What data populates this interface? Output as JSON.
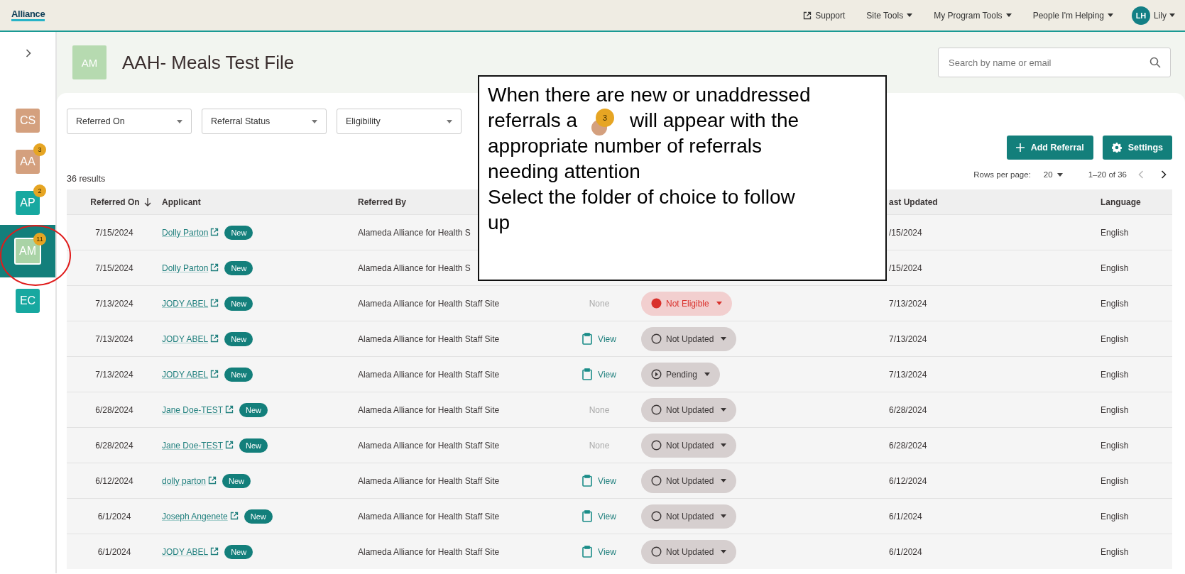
{
  "top_bar": {
    "logo": "Alliance",
    "nav": [
      {
        "label": "Support",
        "kind": "external"
      },
      {
        "label": "Site Tools",
        "kind": "menu"
      },
      {
        "label": "My Program Tools",
        "kind": "menu"
      },
      {
        "label": "People I'm Helping",
        "kind": "menu"
      }
    ],
    "user": {
      "initials": "LH",
      "name": "Lily"
    }
  },
  "sidebar": {
    "items": [
      {
        "initials": "CS",
        "color": "#d4a07e",
        "selected": false
      },
      {
        "initials": "AA",
        "color": "#d4a07e",
        "badge": "3",
        "selected": false
      },
      {
        "initials": "AP",
        "color": "#17a8a0",
        "badge": "2",
        "selected": false
      },
      {
        "initials": "AM",
        "color": "#a9d3a6",
        "badge": "11",
        "selected": true
      },
      {
        "initials": "EC",
        "color": "#17a8a0",
        "selected": false
      }
    ]
  },
  "header": {
    "initials": "AM",
    "title": "AAH- Meals Test File",
    "search": {
      "placeholder": "Search by name or email"
    }
  },
  "filters": [
    "Referred On",
    "Referral Status",
    "Eligibility"
  ],
  "buttons": [
    {
      "label": "Add Referral",
      "kind": "add"
    },
    {
      "label": "Settings",
      "kind": "settings"
    }
  ],
  "results": "36 results",
  "pagination": {
    "rows_label": "Rows per page:",
    "rows_value": "20",
    "range": "1–20 of 36",
    "prev_disabled": true
  },
  "table": {
    "columns": [
      {
        "label": "Referred On",
        "sorted": true
      },
      {
        "label": "Applicant",
        "sorted": false
      },
      {
        "label": "Referred By",
        "sorted": false
      },
      {
        "label": "ast Updated",
        "sorted": false
      },
      {
        "label": "Language",
        "sorted": false
      }
    ],
    "rows": [
      {
        "referred_on": "7/15/2024",
        "applicant": "Dolly Parton",
        "badge": "New",
        "referred_by": "Alameda Alliance for Health S",
        "last_updated": "/15/2024",
        "language": "English"
      },
      {
        "referred_on": "7/15/2024",
        "applicant": "Dolly Parton",
        "badge": "New",
        "referred_by": "Alameda Alliance for Health S",
        "last_updated": "/15/2024",
        "language": "English"
      },
      {
        "referred_on": "7/13/2024",
        "applicant": "JODY ABEL",
        "badge": "New",
        "referred_by": "Alameda Alliance for Health Staff Site",
        "column_4": {
          "kind": "none",
          "label": "None"
        },
        "status": {
          "kind": "not_eligible",
          "label": "Not Eligible"
        },
        "last_updated": "7/13/2024",
        "language": "English"
      },
      {
        "referred_on": "7/13/2024",
        "applicant": "JODY ABEL",
        "badge": "New",
        "referred_by": "Alameda Alliance for Health Staff Site",
        "column_4": {
          "kind": "link",
          "label": "View"
        },
        "status": {
          "kind": "not_updated",
          "label": "Not Updated"
        },
        "last_updated": "7/13/2024",
        "language": "English"
      },
      {
        "referred_on": "7/13/2024",
        "applicant": "JODY ABEL",
        "badge": "New",
        "referred_by": "Alameda Alliance for Health Staff Site",
        "column_4": {
          "kind": "link",
          "label": "View"
        },
        "status": {
          "kind": "pending",
          "label": "Pending"
        },
        "last_updated": "7/13/2024",
        "language": "English"
      },
      {
        "referred_on": "6/28/2024",
        "applicant": "Jane Doe-TEST",
        "badge": "New",
        "referred_by": "Alameda Alliance for Health Staff Site",
        "column_4": {
          "kind": "none",
          "label": "None"
        },
        "status": {
          "kind": "not_updated",
          "label": "Not Updated"
        },
        "last_updated": "6/28/2024",
        "language": "English"
      },
      {
        "referred_on": "6/28/2024",
        "applicant": "Jane Doe-TEST",
        "badge": "New",
        "referred_by": "Alameda Alliance for Health Staff Site",
        "column_4": {
          "kind": "none",
          "label": "None"
        },
        "status": {
          "kind": "not_updated",
          "label": "Not Updated"
        },
        "last_updated": "6/28/2024",
        "language": "English"
      },
      {
        "referred_on": "6/12/2024",
        "applicant": "dolly parton",
        "badge": "New",
        "referred_by": "Alameda Alliance for Health Staff Site",
        "column_4": {
          "kind": "link",
          "label": "View"
        },
        "status": {
          "kind": "not_updated",
          "label": "Not Updated"
        },
        "last_updated": "6/12/2024",
        "language": "English"
      },
      {
        "referred_on": "6/1/2024",
        "applicant": "Joseph Angenete",
        "badge": "New",
        "referred_by": "Alameda Alliance for Health Staff Site",
        "column_4": {
          "kind": "link",
          "label": "View"
        },
        "status": {
          "kind": "not_updated",
          "label": "Not Updated"
        },
        "last_updated": "6/1/2024",
        "language": "English"
      },
      {
        "referred_on": "6/1/2024",
        "applicant": "JODY ABEL",
        "badge": "New",
        "referred_by": "Alameda Alliance for Health Staff Site",
        "column_4": {
          "kind": "link",
          "label": "View"
        },
        "status": {
          "kind": "not_updated",
          "label": "Not Updated"
        },
        "last_updated": "6/1/2024",
        "language": "English"
      }
    ]
  },
  "callout": {
    "line_1": "When there are new or unaddressed",
    "line_2_before": "referrals a",
    "badge": "3",
    "line_2_after": "will appear with the",
    "lines": [
      "appropriate number of referrals",
      "needing attention",
      "Select the folder of choice to follow",
      "up"
    ]
  }
}
